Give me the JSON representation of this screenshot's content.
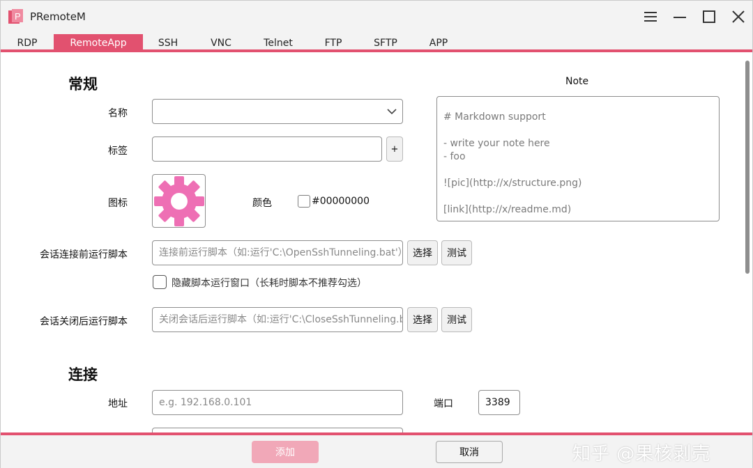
{
  "app": {
    "title": "PRemoteM",
    "logo_letter": "P"
  },
  "colors": {
    "accent": "#e2516f",
    "gear": "#ee6fb4",
    "add_button_disabled": "#f1a8b8"
  },
  "tabs": [
    {
      "label": "RDP",
      "active": false
    },
    {
      "label": "RemoteApp",
      "active": true
    },
    {
      "label": "SSH",
      "active": false
    },
    {
      "label": "VNC",
      "active": false
    },
    {
      "label": "Telnet",
      "active": false
    },
    {
      "label": "FTP",
      "active": false
    },
    {
      "label": "SFTP",
      "active": false
    },
    {
      "label": "APP",
      "active": false
    }
  ],
  "general": {
    "title": "常规",
    "name_label": "名称",
    "name_value": "",
    "tag_label": "标签",
    "tag_value": "",
    "tag_add": "+",
    "icon_label": "图标",
    "icon_name": "gear-icon",
    "color_label": "颜色",
    "color_value": "#00000000",
    "pre_script_label": "会话连接前运行脚本",
    "pre_script_placeholder": "连接前运行脚本（如:运行'C:\\OpenSshTunneling.bat'）",
    "select_label": "选择",
    "test_label": "测试",
    "hide_window_label": "隐藏脚本运行窗口（长耗时脚本不推荐勾选）",
    "hide_window_checked": false,
    "post_script_label": "会话关闭后运行脚本",
    "post_script_placeholder": "关闭会话后运行脚本（如:运行'C:\\CloseSshTunneling.bat'）"
  },
  "note": {
    "title": "Note",
    "lines": [
      "# Markdown support",
      "",
      "- write your note here",
      "- foo",
      "",
      "![pic](http://x/structure.png)",
      "",
      "[link](http://x/readme.md)"
    ]
  },
  "connection": {
    "title": "连接",
    "address_label": "地址",
    "address_placeholder": "e.g. 192.168.0.101",
    "port_label": "端口",
    "port_value": "3389"
  },
  "footer": {
    "add_label": "添加",
    "cancel_label": "取消",
    "watermark": "知乎 @果核剥壳"
  }
}
